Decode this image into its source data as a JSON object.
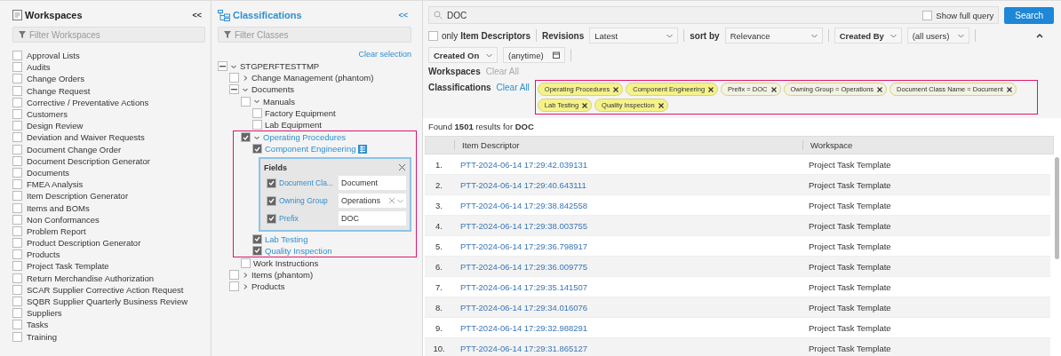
{
  "workspaces": {
    "title": "Workspaces",
    "collapse": "<<",
    "filter_placeholder": "Filter Workspaces",
    "items": [
      {
        "label": "Approval Lists",
        "checked": false
      },
      {
        "label": "Audits",
        "checked": false
      },
      {
        "label": "Change Orders",
        "checked": false
      },
      {
        "label": "Change Request",
        "checked": false
      },
      {
        "label": "Corrective / Preventative Actions",
        "checked": false
      },
      {
        "label": "Customers",
        "checked": false
      },
      {
        "label": "Design Review",
        "checked": false
      },
      {
        "label": "Deviation and Waiver Requests",
        "checked": false
      },
      {
        "label": "Document Change Order",
        "checked": false
      },
      {
        "label": "Document Description Generator",
        "checked": false
      },
      {
        "label": "Documents",
        "checked": false
      },
      {
        "label": "FMEA Analysis",
        "checked": false
      },
      {
        "label": "Item Description Generator",
        "checked": false
      },
      {
        "label": "Items and BOMs",
        "checked": false
      },
      {
        "label": "Non Conformances",
        "checked": false
      },
      {
        "label": "Problem Report",
        "checked": false
      },
      {
        "label": "Product Description Generator",
        "checked": false
      },
      {
        "label": "Products",
        "checked": false
      },
      {
        "label": "Project Task Template",
        "checked": false
      },
      {
        "label": "Return Merchandise Authorization",
        "checked": false
      },
      {
        "label": "SCAR Supplier Corrective Action Request",
        "checked": false
      },
      {
        "label": "SQBR Supplier Quarterly Business Review",
        "checked": false
      },
      {
        "label": "Suppliers",
        "checked": false
      },
      {
        "label": "Tasks",
        "checked": false
      },
      {
        "label": "Training",
        "checked": false
      }
    ]
  },
  "classifications": {
    "title": "Classifications",
    "collapse": "<<",
    "filter_placeholder": "Filter Classes",
    "clear_selection": "Clear selection",
    "tree": [
      {
        "label": "STGPERFTESTTMP",
        "checked": false,
        "partial": true,
        "expanded": true,
        "children": [
          {
            "label": "Change Management (phantom)",
            "checked": false,
            "partial": false,
            "expanded": false
          },
          {
            "label": "Documents",
            "checked": false,
            "partial": true,
            "expanded": true,
            "children": [
              {
                "label": "Manuals",
                "checked": false,
                "partial": false,
                "expanded": true,
                "children": [
                  {
                    "label": "Factory Equipment",
                    "checked": false,
                    "partial": false
                  },
                  {
                    "label": "Lab Equipment",
                    "checked": false,
                    "partial": false
                  }
                ]
              },
              {
                "label": "Operating Procedures",
                "checked": true,
                "partial": false,
                "expanded": true,
                "highlighted": true,
                "children": [
                  {
                    "label": "Component Engineering",
                    "checked": true,
                    "partial": false,
                    "fields": {
                      "title": "Fields",
                      "rows": [
                        {
                          "kind": "text",
                          "label": "Document Cla...",
                          "checked": true,
                          "value": "Document"
                        },
                        {
                          "kind": "select",
                          "label": "Owning Group",
                          "checked": true,
                          "value": "Operations"
                        },
                        {
                          "kind": "text",
                          "label": "Prefix",
                          "checked": true,
                          "value": "DOC"
                        }
                      ]
                    }
                  },
                  {
                    "label": "Lab Testing",
                    "checked": true,
                    "partial": false
                  },
                  {
                    "label": "Quality Inspection",
                    "checked": true,
                    "partial": false
                  }
                ]
              },
              {
                "label": "Work Instructions",
                "checked": false,
                "partial": false
              }
            ]
          },
          {
            "label": "Items (phantom)",
            "checked": false,
            "partial": false,
            "expanded": false
          },
          {
            "label": "Products",
            "checked": false,
            "partial": false,
            "expanded": false
          }
        ]
      }
    ]
  },
  "search": {
    "value": "DOC",
    "show_full_query": {
      "label": "Show full query",
      "checked": false
    },
    "button": "Search"
  },
  "filters": {
    "only_descriptors": {
      "label": "only **Item Descriptors**",
      "checked": false
    },
    "revisions": {
      "label": "Revisions",
      "value": "Latest"
    },
    "sort": {
      "label": "sort by",
      "value": "Relevance"
    },
    "created_by": {
      "value": "Created By"
    },
    "users": {
      "value": "(all users)"
    },
    "created_on": {
      "value": "Created On"
    },
    "date": {
      "value": "(anytime)"
    },
    "workspaces": {
      "label": "Workspaces",
      "clear": "Clear All",
      "clear_disabled": true
    },
    "classifications": {
      "label": "Classifications",
      "clear": "Clear All",
      "clear_disabled": false,
      "chips": [
        {
          "kind": "class",
          "label": "Operating Procedures"
        },
        {
          "kind": "class",
          "label": "Component Engineering"
        },
        {
          "kind": "field",
          "label": "Prefix = DOC"
        },
        {
          "kind": "field",
          "label": "Owning Group = Operations"
        },
        {
          "kind": "field",
          "label": "Document Class Name = Document"
        },
        {
          "kind": "class",
          "label": "Lab Testing"
        },
        {
          "kind": "class",
          "label": "Quality Inspection"
        }
      ]
    }
  },
  "results": {
    "summary": "Found **1501** results for **DOC**",
    "columns": [
      "Item Descriptor",
      "Workspace"
    ],
    "rows": [
      {
        "index": "1.",
        "descriptor": "PTT-2024-06-14 17:29:42.039131",
        "workspace": "Project Task Template"
      },
      {
        "index": "2.",
        "descriptor": "PTT-2024-06-14 17:29:40.643111",
        "workspace": "Project Task Template"
      },
      {
        "index": "3.",
        "descriptor": "PTT-2024-06-14 17:29:38.842558",
        "workspace": "Project Task Template"
      },
      {
        "index": "4.",
        "descriptor": "PTT-2024-06-14 17:29:38.003755",
        "workspace": "Project Task Template"
      },
      {
        "index": "5.",
        "descriptor": "PTT-2024-06-14 17:29:36.798917",
        "workspace": "Project Task Template"
      },
      {
        "index": "6.",
        "descriptor": "PTT-2024-06-14 17:29:36.009775",
        "workspace": "Project Task Template"
      },
      {
        "index": "7.",
        "descriptor": "PTT-2024-06-14 17:29:35.141507",
        "workspace": "Project Task Template"
      },
      {
        "index": "8.",
        "descriptor": "PTT-2024-06-14 17:29:34.016076",
        "workspace": "Project Task Template"
      },
      {
        "index": "9.",
        "descriptor": "PTT-2024-06-14 17:29:32.988291",
        "workspace": "Project Task Template"
      },
      {
        "index": "10.",
        "descriptor": "PTT-2024-06-14 17:29:31.865127",
        "workspace": "Project Task Template"
      }
    ]
  }
}
